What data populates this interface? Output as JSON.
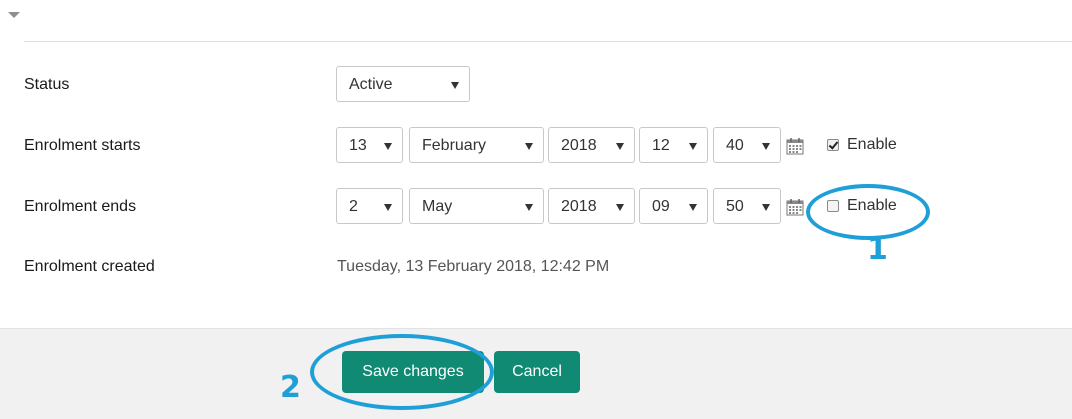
{
  "form": {
    "status": {
      "label": "Status",
      "value": "Active"
    },
    "enrolment_starts": {
      "label": "Enrolment starts",
      "day": "13",
      "month": "February",
      "year": "2018",
      "hour": "12",
      "minute": "40",
      "enable_label": "Enable",
      "enabled": true
    },
    "enrolment_ends": {
      "label": "Enrolment ends",
      "day": "2",
      "month": "May",
      "year": "2018",
      "hour": "09",
      "minute": "50",
      "enable_label": "Enable",
      "enabled": false
    },
    "enrolment_created": {
      "label": "Enrolment created",
      "value": "Tuesday, 13 February 2018, 12:42 PM"
    }
  },
  "footer": {
    "save_label": "Save changes",
    "cancel_label": "Cancel"
  },
  "annotations": {
    "marker_1": "1",
    "marker_2": "2",
    "color": "#1f9fd8"
  },
  "colors": {
    "primary_button": "#108a72",
    "footer_background": "#f1f1f1"
  },
  "icons": {
    "section_toggle": "caret-down-icon",
    "date_picker": "calendar-icon"
  }
}
